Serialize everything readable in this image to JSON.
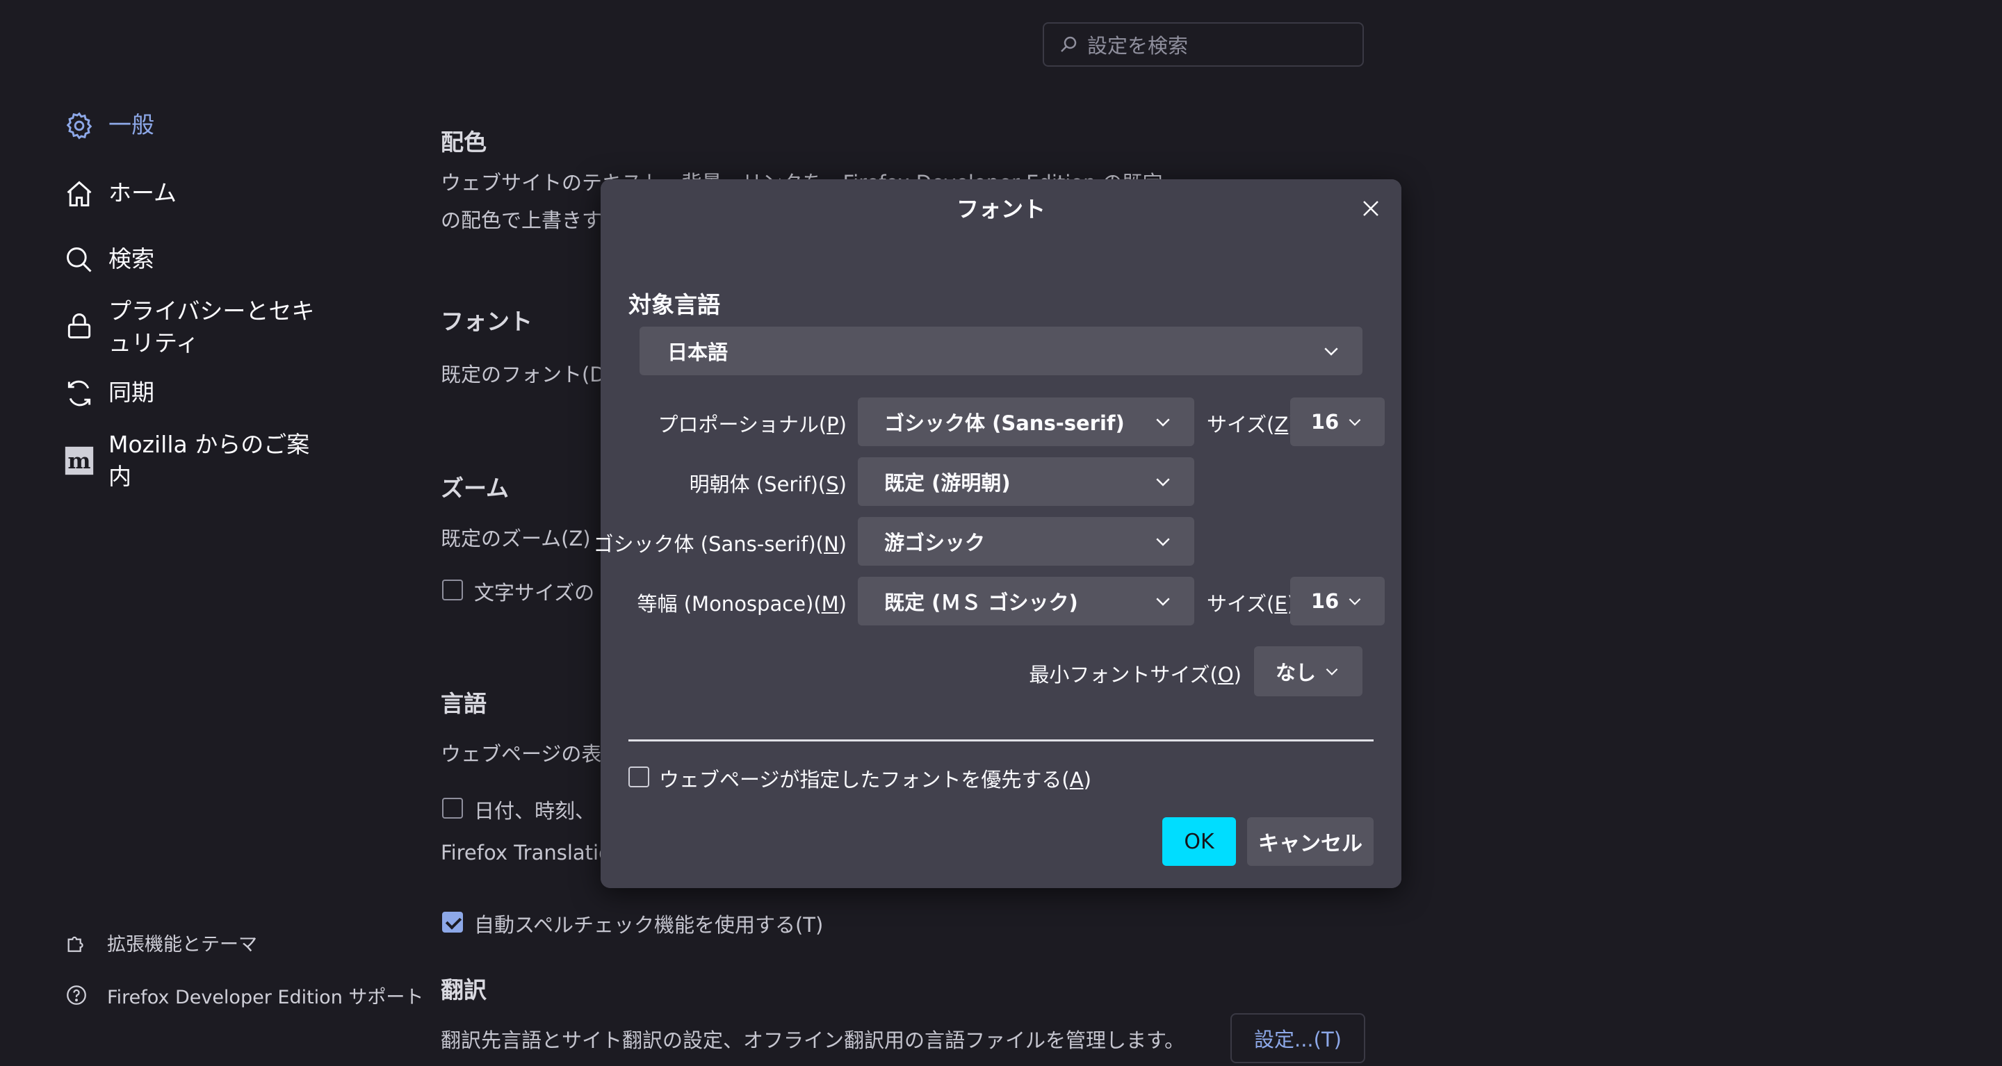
{
  "search": {
    "placeholder": "設定を検索"
  },
  "sidebar": {
    "items": [
      {
        "label": "一般",
        "icon": "gear-icon",
        "active": true
      },
      {
        "label": "ホーム",
        "icon": "home-icon"
      },
      {
        "label": "検索",
        "icon": "search-icon"
      },
      {
        "label": "プライバシーとセキュリティ",
        "icon": "lock-icon"
      },
      {
        "label": "同期",
        "icon": "sync-icon"
      },
      {
        "label": "Mozilla からのご案内",
        "icon": "mozilla-icon"
      }
    ],
    "footer": [
      {
        "label": "拡張機能とテーマ",
        "icon": "puzzle-icon"
      },
      {
        "label": "Firefox Developer Edition サポート",
        "icon": "help-icon"
      }
    ]
  },
  "background": {
    "colors_heading": "配色",
    "colors_text_1": "ウェブサイトのテキスト、背景、リンクを、Firefox Developer Edition の既定",
    "colors_text_2": "の配色で上書きす",
    "fonts_heading": "フォント",
    "fonts_text": "既定のフォント(D",
    "zoom_heading": "ズーム",
    "zoom_text": "既定のズーム(Z)",
    "zoom_checkbox": "文字サイズの",
    "language_heading": "言語",
    "language_text": "ウェブページの表",
    "language_checkbox": "日付、時刻、",
    "translations_text": "Firefox Translatio",
    "spellcheck_label": "自動スペルチェック機能を使用する(T)",
    "translate_heading": "翻訳",
    "translate_text": "翻訳先言語とサイト翻訳の設定、オフライン翻訳用の言語ファイルを管理します。",
    "translate_button": "設定...(T)"
  },
  "dialog": {
    "title": "フォント",
    "lang_label": "対象言語",
    "lang_value": "日本語",
    "rows": [
      {
        "label": "プロポーショナル(",
        "key": "P",
        "value": "ゴシック体 (Sans-serif)"
      },
      {
        "label": "明朝体 (Serif)(",
        "key": "S",
        "value": "既定 (游明朝)"
      },
      {
        "label": "ゴシック体 (Sans-serif)(",
        "key": "N",
        "value": "游ゴシック"
      },
      {
        "label": "等幅 (Monospace)(",
        "key": "M",
        "value": "既定 (ＭＳ ゴシック)"
      }
    ],
    "size_label_1": "サイズ(",
    "size_key_1": "Z",
    "size_value_1": "16",
    "size_label_2": "サイズ(",
    "size_key_2": "E",
    "size_value_2": "16",
    "min_size_label": "最小フォントサイズ(",
    "min_size_key": "O",
    "min_size_value": "なし",
    "allow_pages_label": "ウェブページが指定したフォントを優先する(",
    "allow_pages_key": "A",
    "ok_label": "OK",
    "cancel_label": "キャンセル"
  }
}
